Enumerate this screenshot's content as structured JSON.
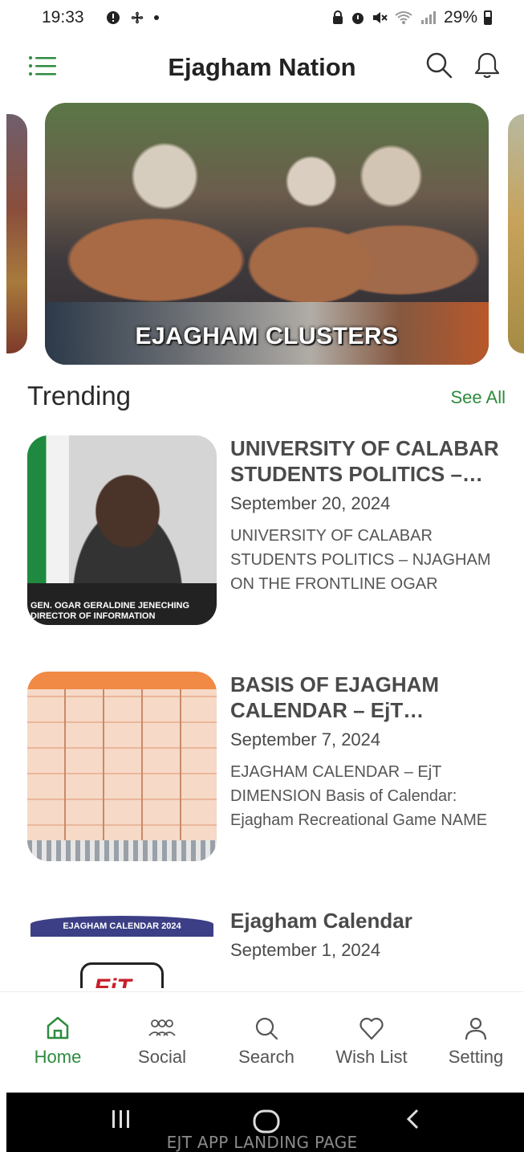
{
  "status_bar": {
    "time": "19:33",
    "battery_percent": "29%"
  },
  "app_bar": {
    "title": "Ejagham Nation",
    "icons": [
      "menu-icon",
      "search-icon",
      "bell-icon"
    ]
  },
  "carousel": {
    "slides": [
      {
        "caption": "EJAGHAM CLUSTERS"
      }
    ]
  },
  "trending": {
    "title": "Trending",
    "see_all_label": "See All",
    "articles": [
      {
        "title": "UNIVERSITY OF CALABAR STUDENTS POLITICS – NJ...",
        "date": "September 20, 2024",
        "excerpt": "UNIVERSITY OF CALABAR STUDENTS POLITICS – NJAGHAM ON THE FRONTLINE OGAR",
        "thumb_caption_1": "GEN. OGAR GERALDINE JENECHING",
        "thumb_caption_2": "DIRECTOR OF INFORMATION"
      },
      {
        "title": "BASIS OF EJAGHAM CALENDAR – EjT Dimension",
        "date": "September 7, 2024",
        "excerpt": "EJAGHAM CALENDAR – EjT DIMENSION Basis of Calendar: Ejagham Recreational Game NAME"
      },
      {
        "title": "Ejagham Calendar",
        "date": "September 1, 2024",
        "thumb_banner": "EJAGHAM CALENDAR 2024",
        "thumb_logo": "EjT"
      }
    ]
  },
  "bottom_nav": {
    "items": [
      {
        "label": "Home",
        "icon": "home-icon",
        "active": true
      },
      {
        "label": "Social",
        "icon": "people-icon",
        "active": false
      },
      {
        "label": "Search",
        "icon": "search-icon",
        "active": false
      },
      {
        "label": "Wish List",
        "icon": "heart-icon",
        "active": false
      },
      {
        "label": "Setting",
        "icon": "user-icon",
        "active": false
      }
    ]
  },
  "colors": {
    "accent": "#2e8b3f",
    "text_dark": "#222222",
    "text_muted": "#555555"
  },
  "footer_caption": "EJT APP LANDING PAGE"
}
